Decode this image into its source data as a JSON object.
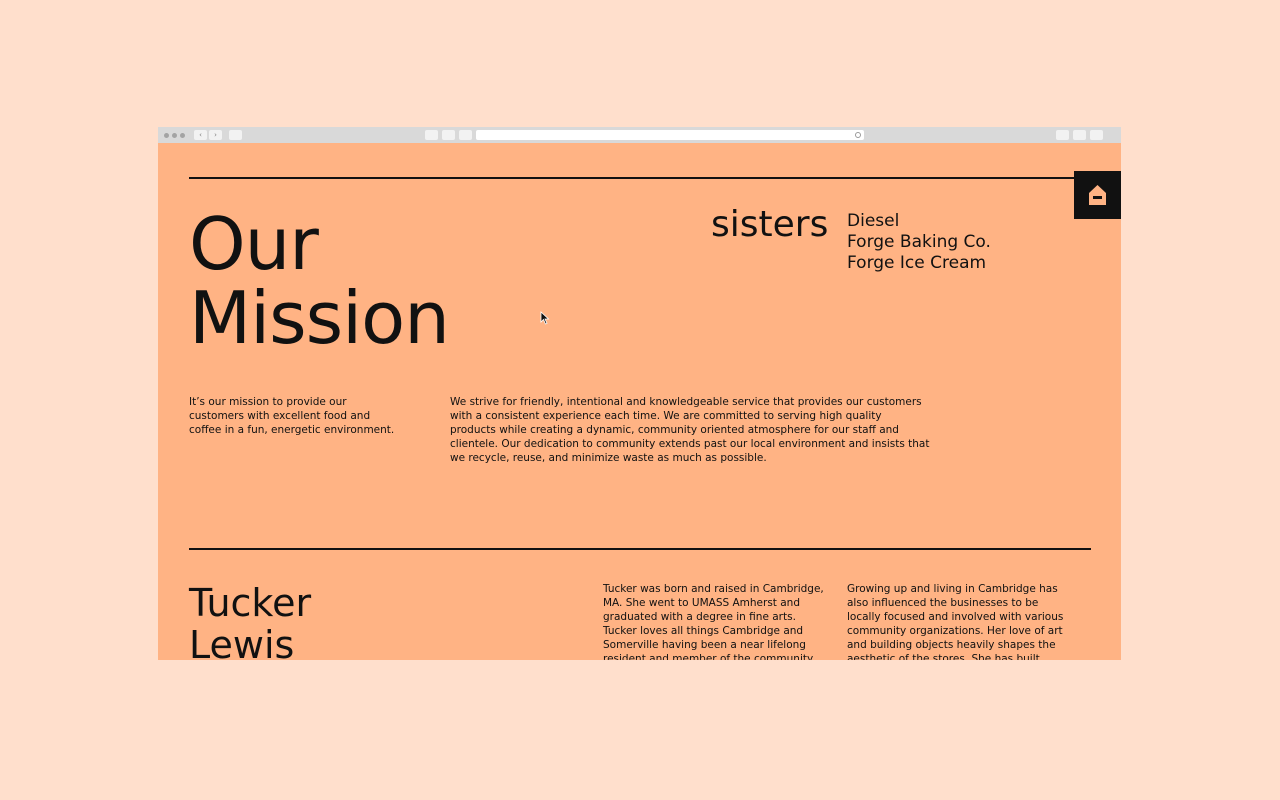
{
  "browser": {
    "toolbar_icons": [
      "traffic-light-dots",
      "back-icon",
      "forward-icon",
      "sidebar-icon",
      "history-icon",
      "reader-icon",
      "home-icon",
      "reload-icon",
      "download-icon",
      "share-icon",
      "settings-icon"
    ]
  },
  "colors": {
    "page_background": "#ffdfcc",
    "site_background": "#ffb384",
    "text": "#111111"
  },
  "mission": {
    "title_line1": "Our",
    "title_line2": "Mission",
    "sisters_label": "sisters",
    "sisters": [
      "Diesel",
      "Forge Baking Co.",
      "Forge Ice Cream"
    ],
    "intro": "It’s our mission to provide our customers with excellent food and coffee in a fun, energetic environment.",
    "body": "We strive for friendly, intentional and knowledgeable service that provides our customers with a consistent experience each time. We are committed to serving high quality products while creating a dynamic, community oriented atmosphere for our staff and clientele. Our dedication to community extends past our local environment and insists that we recycle, reuse, and minimize waste as much as possible."
  },
  "bio": {
    "first_name": "Tucker",
    "last_name": "Lewis",
    "col1": "Tucker was born and raised in Cambridge, MA. She went to UMASS Amherst and graduated with a degree in fine arts. Tucker loves all things Cambridge and Somerville having been a near lifelong resident and member of the community.",
    "col2": "Growing up and living in Cambridge has also influenced the businesses to be locally focused and involved with various community organizations. Her love of art and building objects heavily shapes the aesthetic of the stores. She has built"
  }
}
